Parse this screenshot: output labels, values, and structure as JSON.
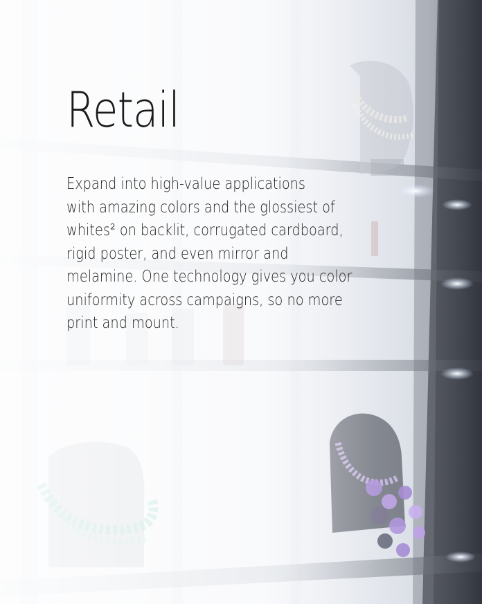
{
  "heading": "Retail",
  "body_lines": [
    "Expand into high-value applications",
    "with amazing colors and the glossiest of",
    "whites² on backlit, corrugated cardboard,",
    "rigid poster, and even mirror and",
    "melamine. One technology gives you color",
    "uniformity across campaigns, so no more",
    "print and mount."
  ],
  "colors": {
    "text": "#222222",
    "background": "#f4f6f9",
    "shelf_dark": "#3a3e46",
    "necklace_purple": "#a78ad8",
    "necklace_teal": "#8fd4c6"
  }
}
